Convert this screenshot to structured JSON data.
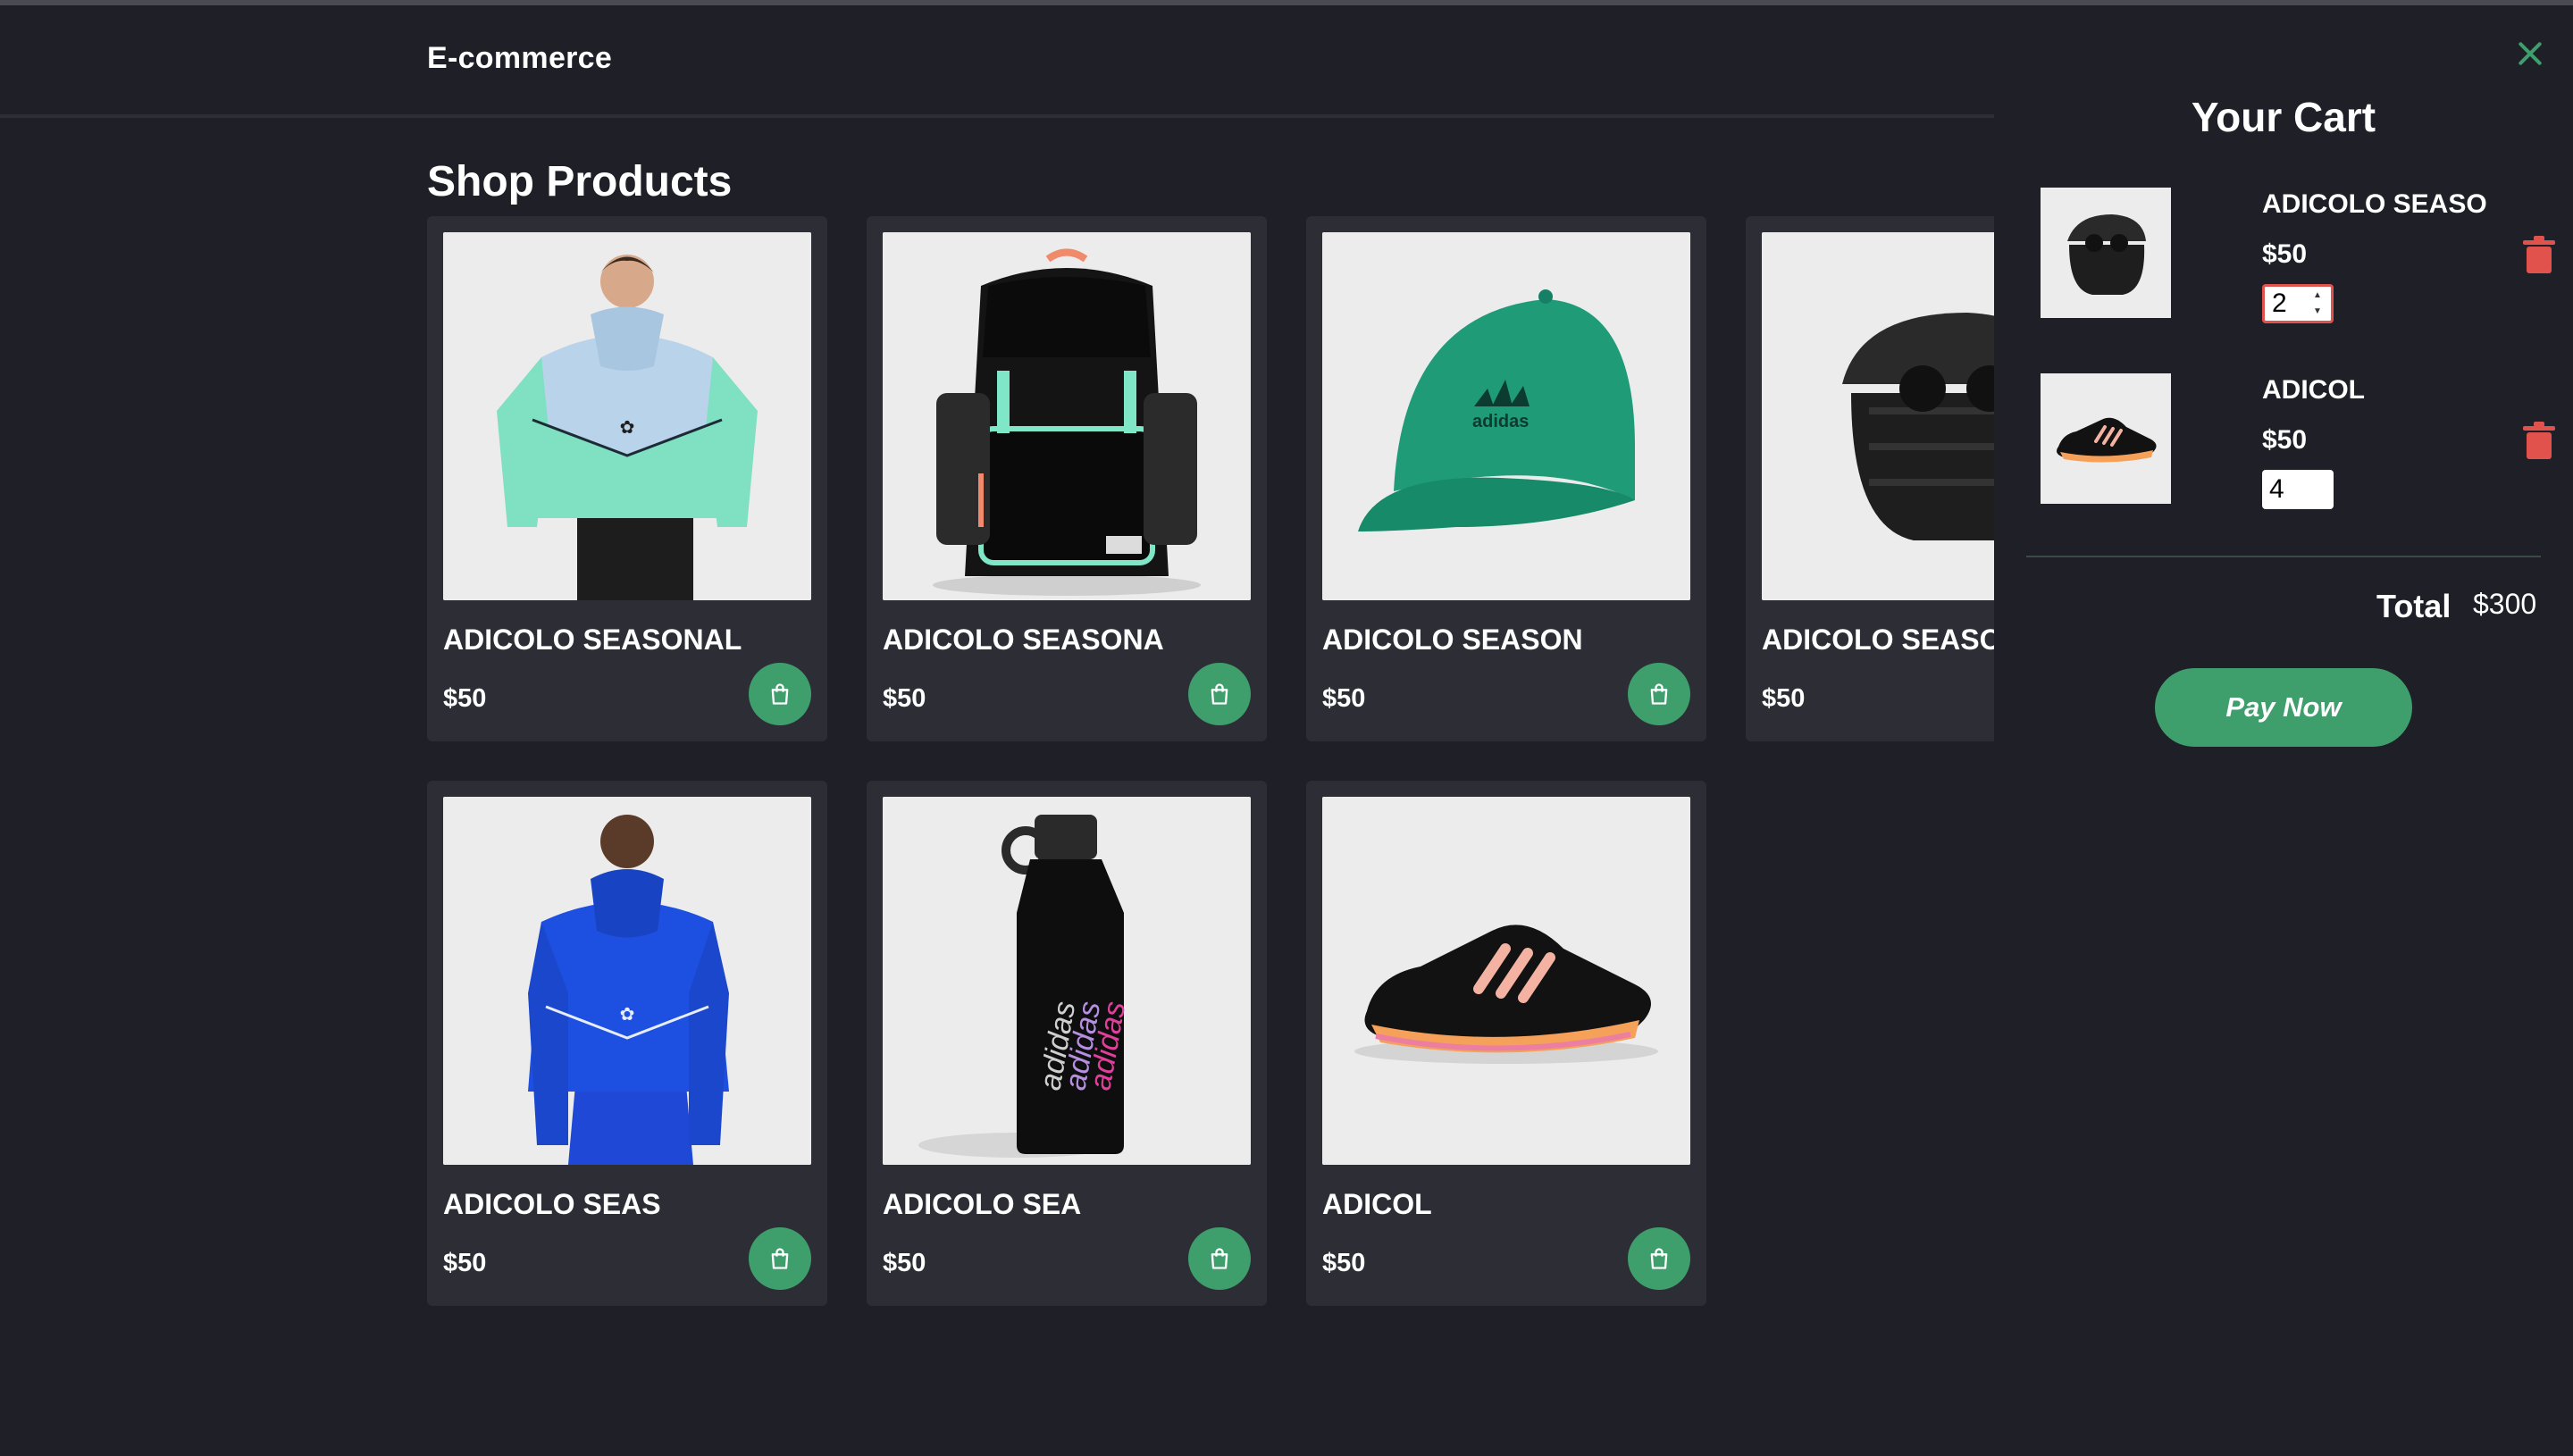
{
  "app": {
    "brand": "E-commerce"
  },
  "shop": {
    "title": "Shop Products",
    "products": [
      {
        "name": "ADICOLO SEASONAL",
        "price": "$50",
        "image": "blue-hoodie"
      },
      {
        "name": "ADICOLO SEASONA",
        "price": "$50",
        "image": "black-backpack"
      },
      {
        "name": "ADICOLO SEASON",
        "price": "$50",
        "image": "green-cap"
      },
      {
        "name": "ADICOLO SEASO",
        "price": "$50",
        "image": "earbuds-case"
      },
      {
        "name": "ADICOLO SEAS",
        "price": "$50",
        "image": "royal-blue-hoodie"
      },
      {
        "name": "ADICOLO SEA",
        "price": "$50",
        "image": "black-water-bottle"
      },
      {
        "name": "ADICOL",
        "price": "$50",
        "image": "running-shoe"
      }
    ]
  },
  "cart": {
    "title": "Your Cart",
    "items": [
      {
        "name": "ADICOLO SEASO",
        "price": "$50",
        "qty": "2",
        "image": "earbuds-case"
      },
      {
        "name": "ADICOL",
        "price": "$50",
        "qty": "4",
        "image": "running-shoe"
      }
    ],
    "total_label": "Total",
    "total_value": "$300",
    "pay_label": "Pay Now"
  },
  "icons": {
    "close": "close-icon",
    "add_to_cart": "shopping-bag-icon",
    "remove": "trash-icon"
  },
  "colors": {
    "background": "#1e1f27",
    "card": "#2c2d35",
    "accent": "#3e9e6c",
    "danger": "#e0524b"
  }
}
